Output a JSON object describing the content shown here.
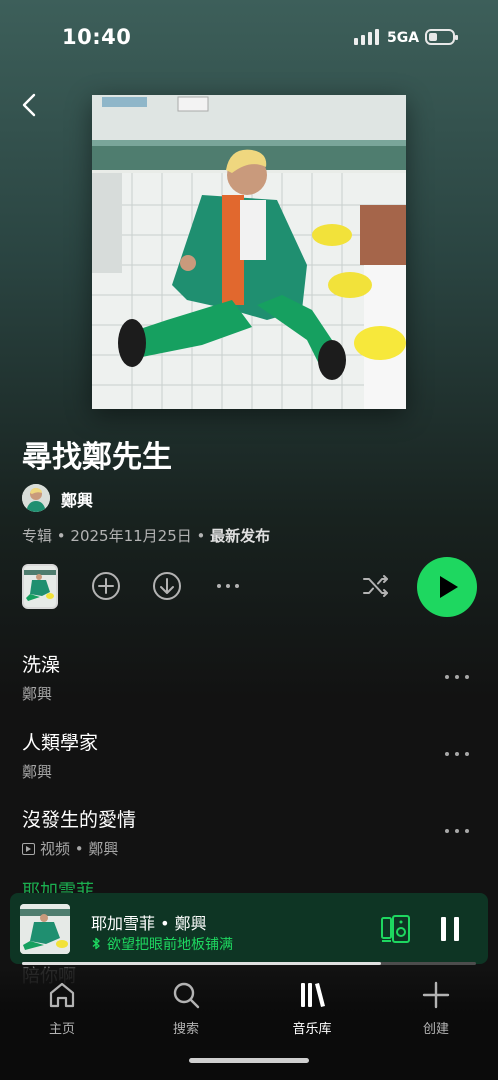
{
  "status_bar": {
    "time": "10:40",
    "network": "5GA"
  },
  "album": {
    "title": "尋找鄭先生",
    "artist": "鄭興",
    "type": "专辑",
    "date": "2025年11月25日",
    "badge": "最新发布"
  },
  "colors": {
    "accent": "#1ed760",
    "background": "#121212",
    "mini_player": "#0e3524"
  },
  "tracks": [
    {
      "title": "洗澡",
      "artist": "鄭興"
    },
    {
      "title": "人類學家",
      "artist": "鄭興"
    },
    {
      "title": "沒發生的愛情",
      "kind": "视频",
      "artist": "鄭興"
    }
  ],
  "partial_tracks": [
    "耶加雪菲",
    "陪你啊"
  ],
  "mini_player": {
    "title": "耶加雪菲 • 鄭興",
    "device": "欲望把眼前地板铺满",
    "progress": 0.79
  },
  "nav": [
    {
      "label": "主页",
      "icon": "home-icon"
    },
    {
      "label": "搜索",
      "icon": "search-icon"
    },
    {
      "label": "音乐库",
      "icon": "library-icon",
      "active": true
    },
    {
      "label": "创建",
      "icon": "plus-icon"
    }
  ]
}
